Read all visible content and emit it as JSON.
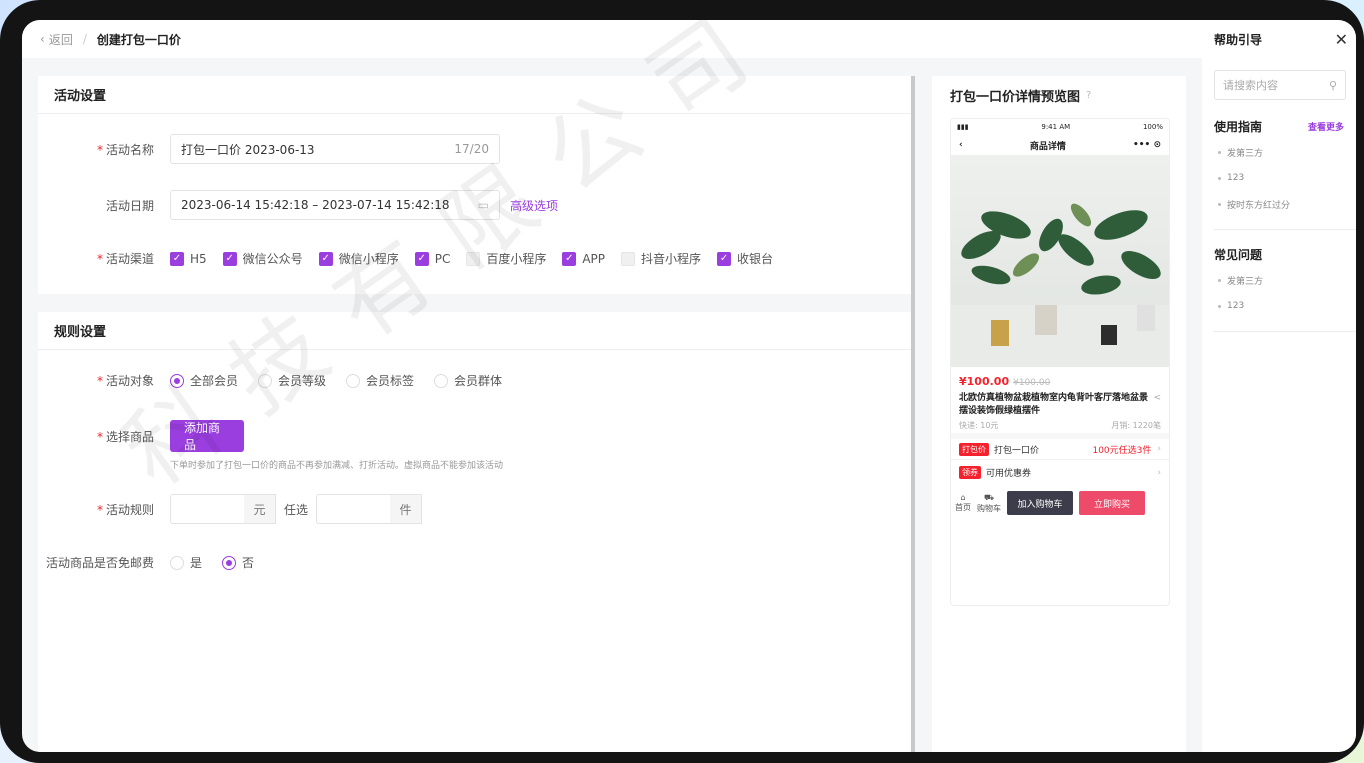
{
  "header": {
    "back_label": "返回",
    "separator": "/",
    "title": "创建打包一口价"
  },
  "activity_settings": {
    "title": "活动设置",
    "name_label": "活动名称",
    "name_value": "打包一口价  2023-06-13",
    "name_count": "17/20",
    "date_label": "活动日期",
    "date_value": "2023-06-14 15:42:18  –  2023-07-14 15:42:18",
    "advanced_link": "高级选项",
    "channel_label": "活动渠道",
    "channels": [
      {
        "label": "H5",
        "checked": true
      },
      {
        "label": "微信公众号",
        "checked": true
      },
      {
        "label": "微信小程序",
        "checked": true
      },
      {
        "label": "PC",
        "checked": true
      },
      {
        "label": "百度小程序",
        "checked": false
      },
      {
        "label": "APP",
        "checked": true
      },
      {
        "label": "抖音小程序",
        "checked": false
      },
      {
        "label": "收银台",
        "checked": true
      }
    ]
  },
  "rule_settings": {
    "title": "规则设置",
    "target_label": "活动对象",
    "targets": [
      {
        "label": "全部会员",
        "selected": true
      },
      {
        "label": "会员等级",
        "selected": false
      },
      {
        "label": "会员标签",
        "selected": false
      },
      {
        "label": "会员群体",
        "selected": false
      }
    ],
    "goods_label": "选择商品",
    "add_goods_button": "添加商品",
    "goods_hint": "下单时参加了打包一口价的商品不再参加满减、打折活动。虚拟商品不能参加该活动",
    "rule_label": "活动规则",
    "unit_yuan": "元",
    "pick_text": "任选",
    "unit_jian": "件",
    "free_shipping_label": "活动商品是否免邮费",
    "free_shipping_options": [
      {
        "label": "是",
        "selected": false
      },
      {
        "label": "否",
        "selected": true
      }
    ]
  },
  "preview": {
    "title": "打包一口价详情预览图",
    "status_time": "9:41 AM",
    "status_battery": "100%",
    "nav_title": "商品详情",
    "price": "¥100.00",
    "old_price": "¥100.00",
    "product_title": "北欧仿真植物盆栽植物室内龟背叶客厅落地盆景摆设装饰假绿植摆件",
    "shipping": "快递: 10元",
    "monthly_sales": "月销: 1220笔",
    "bundle_tag": "打包价",
    "bundle_name": "打包一口价",
    "bundle_offer": "100元任选3件",
    "coupon_tag": "领券",
    "coupon_text": "可用优惠券",
    "home_label": "首页",
    "cart_label": "购物车",
    "add_cart_button": "加入购物车",
    "buy_button": "立即购买"
  },
  "help": {
    "title": "帮助引导",
    "search_placeholder": "请搜索内容",
    "guide_title": "使用指南",
    "view_more": "查看更多",
    "guide_items": [
      "发第三方",
      "123",
      "按时东方红过分"
    ],
    "faq_title": "常见问题",
    "faq_items": [
      "发第三方",
      "123"
    ]
  },
  "watermark": "科技有限公司",
  "colors": {
    "accent": "#9a3ee0",
    "danger": "#f5222d",
    "buy": "#ee4a6a"
  }
}
